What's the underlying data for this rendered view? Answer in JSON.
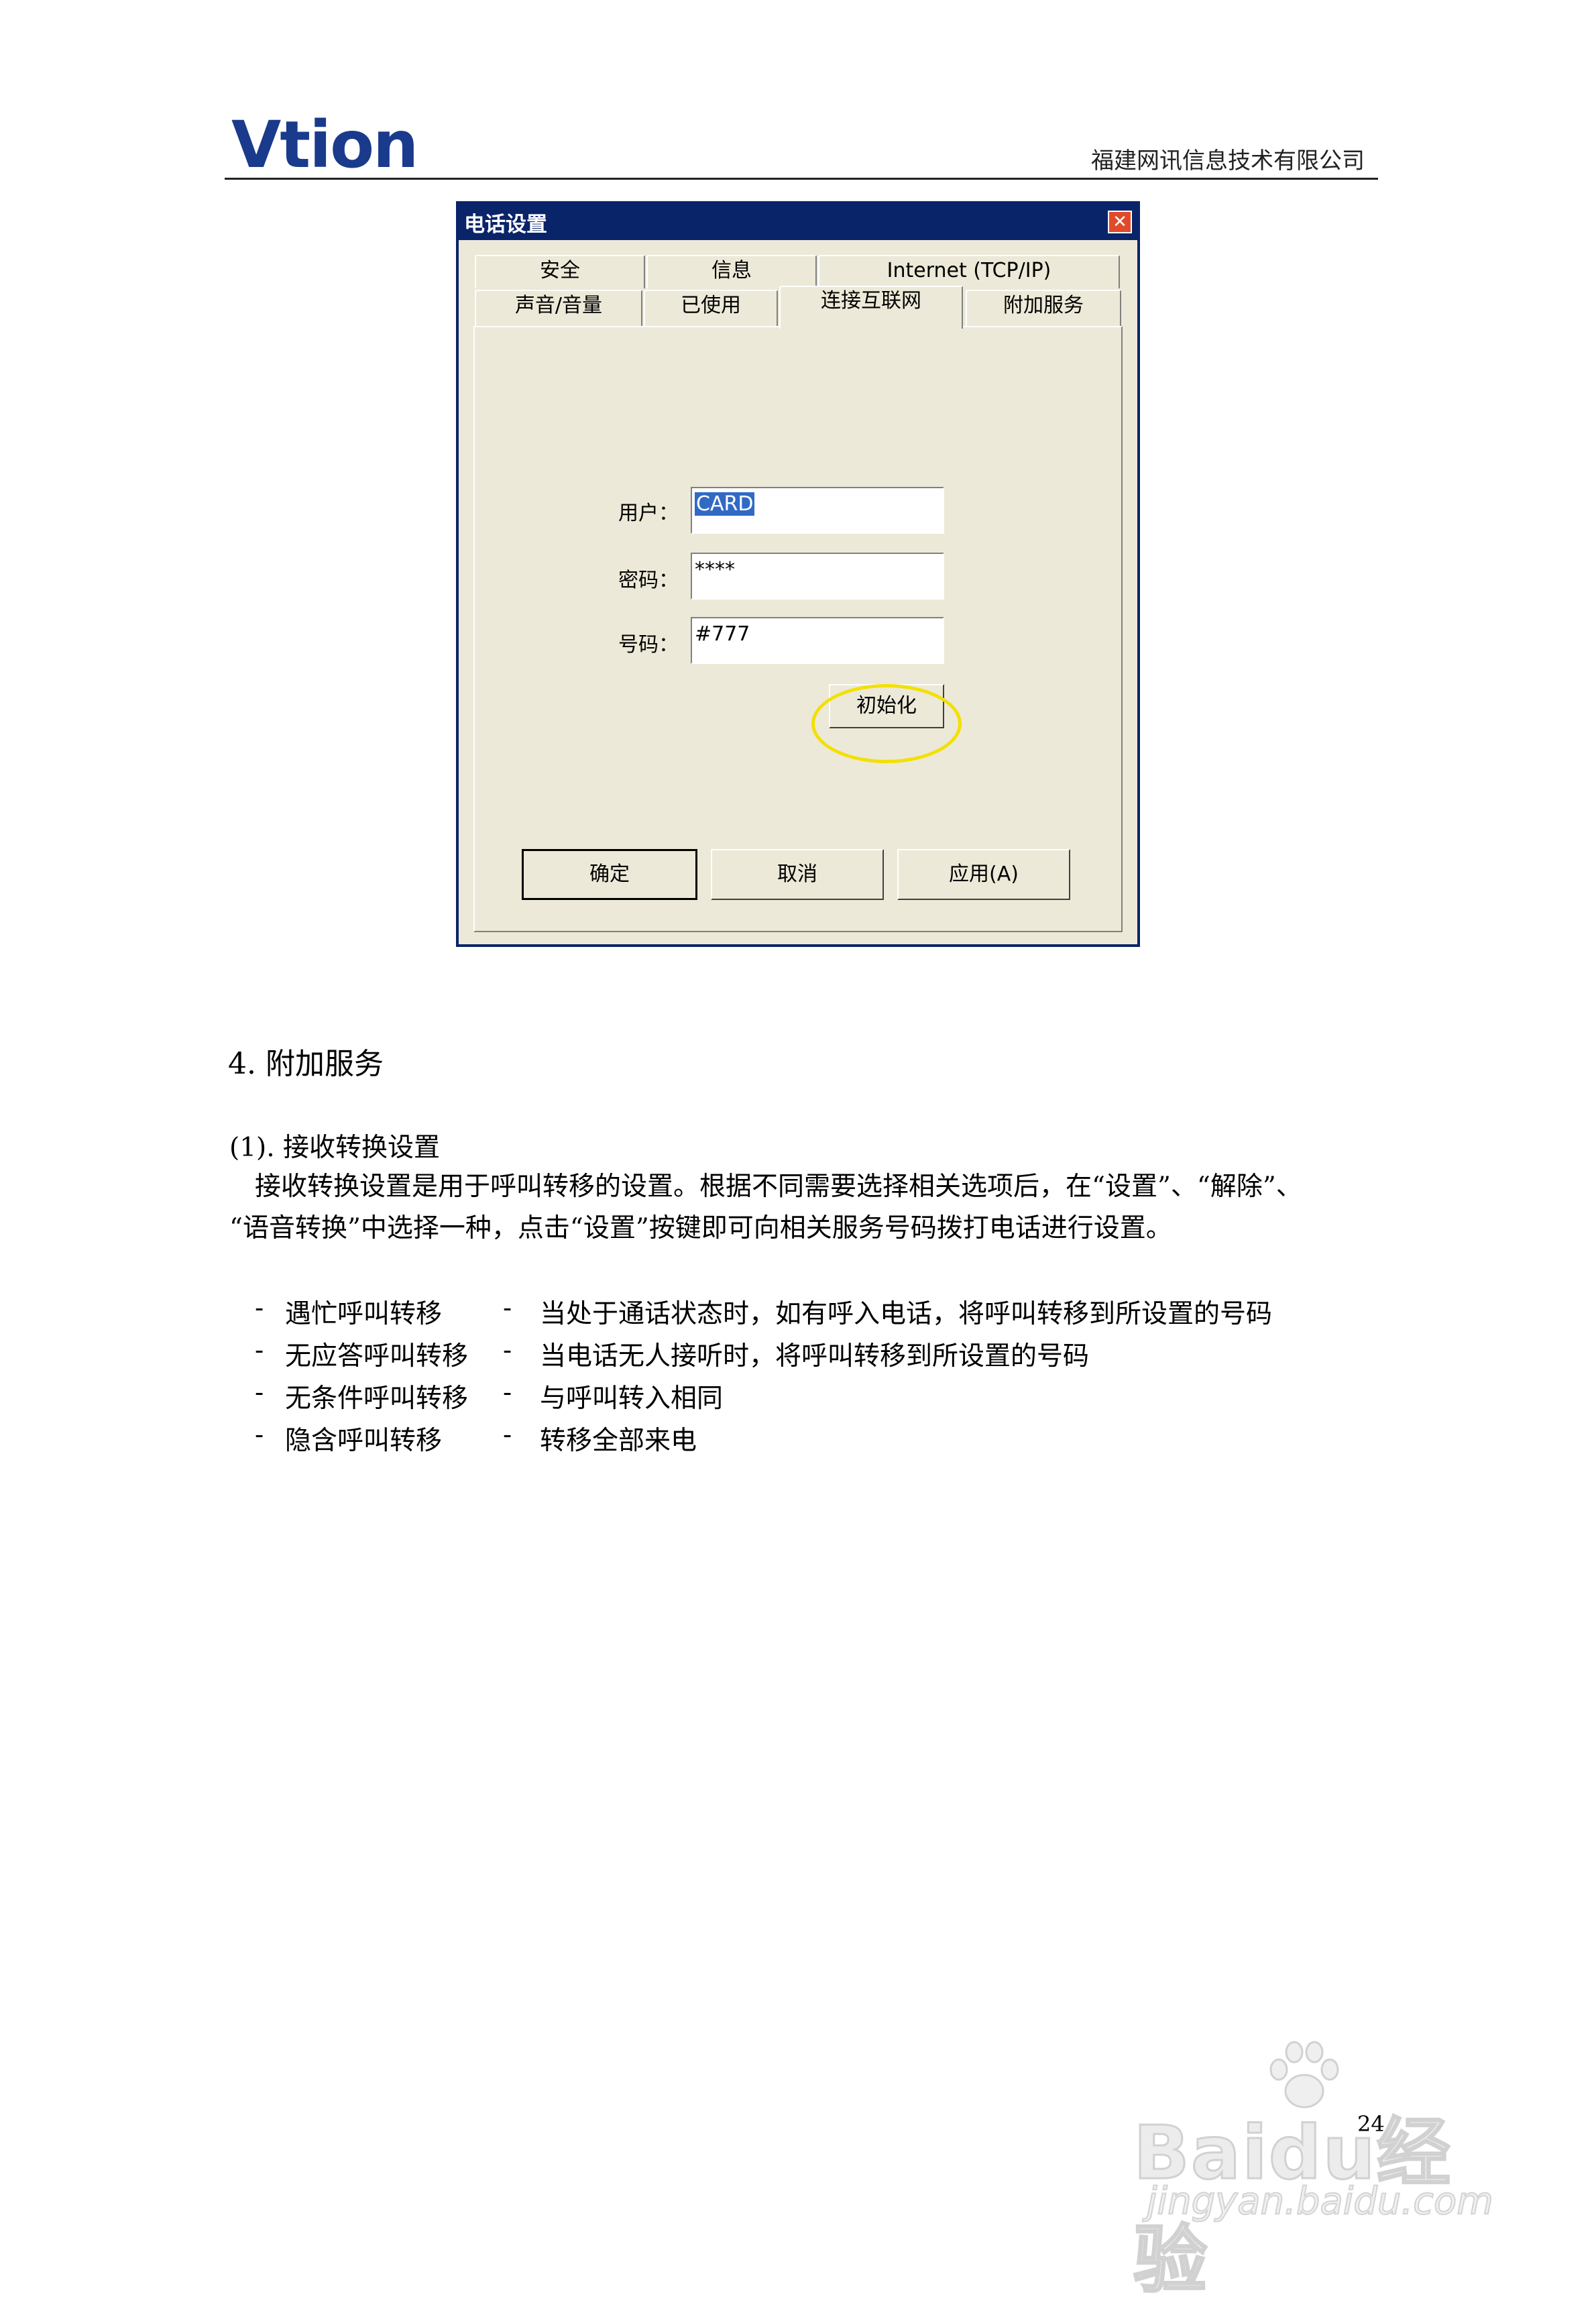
{
  "header": {
    "logo_text": "Vtion",
    "company": "福建网讯信息技术有限公司"
  },
  "dialog": {
    "title": "电话设置",
    "close_glyph": "✕",
    "tabs_row1": [
      "安全",
      "信息",
      "Internet (TCP/IP)"
    ],
    "tabs_row2": [
      "声音/音量",
      "已使用",
      "连接互联网",
      "附加服务"
    ],
    "active_tab": "连接互联网",
    "fields": {
      "user_label": "用户：",
      "user_value": "CARD",
      "password_label": "密码：",
      "password_value": "****",
      "number_label": "号码：",
      "number_value": "#777"
    },
    "init_button": "初始化",
    "ok_button": "确定",
    "cancel_button": "取消",
    "apply_button": "应用(A)"
  },
  "body": {
    "section_title": "4. 附加服务",
    "subsection_title": "(1). 接收转换设置",
    "paragraph_line1": "接收转换设置是用于呼叫转移的设置。根据不同需要选择相关选项后，在“设置”、“解除”、",
    "paragraph_line2": "“语音转换”中选择一种，点击“设置”按键即可向相关服务号码拨打电话进行设置。",
    "list": [
      {
        "dash": "-",
        "name": "遇忙呼叫转移",
        "sep": "-",
        "desc": "当处于通话状态时，如有呼入电话，将呼叫转移到所设置的号码"
      },
      {
        "dash": "-",
        "name": "无应答呼叫转移",
        "sep": "-",
        "desc": "当电话无人接听时，将呼叫转移到所设置的号码"
      },
      {
        "dash": "-",
        "name": "无条件呼叫转移",
        "sep": "-",
        "desc": "与呼叫转入相同"
      },
      {
        "dash": "-",
        "name": "隐含呼叫转移",
        "sep": "-",
        "desc": "转移全部来电"
      }
    ]
  },
  "footer": {
    "page_number": "24",
    "watermark_brand": "Baidu经验",
    "watermark_url": "jingyan.baidu.com"
  }
}
